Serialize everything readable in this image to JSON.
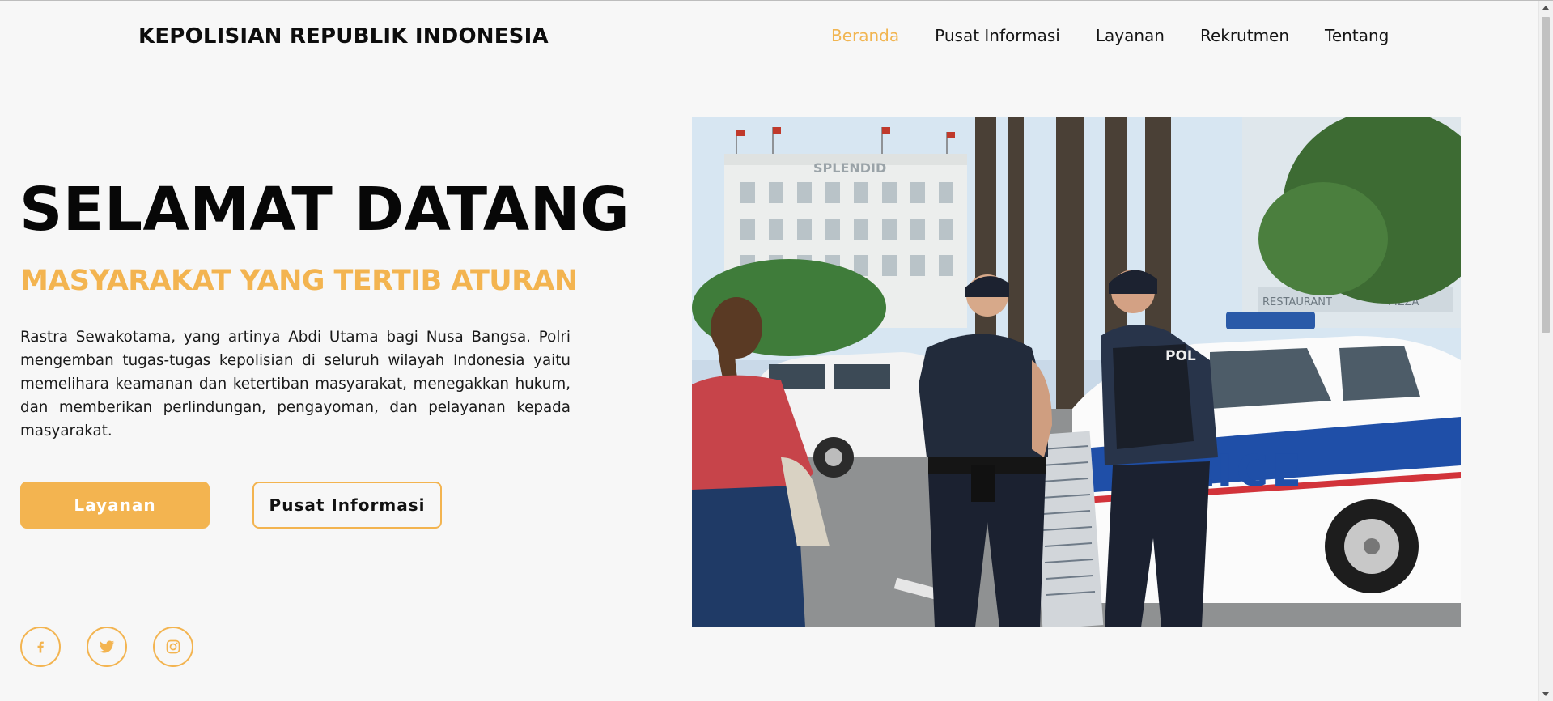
{
  "header": {
    "site_title": "KEPOLISIAN REPUBLIK INDONESIA",
    "nav": [
      {
        "label": "Beranda",
        "active": true
      },
      {
        "label": "Pusat Informasi",
        "active": false
      },
      {
        "label": "Layanan",
        "active": false
      },
      {
        "label": "Rekrutmen",
        "active": false
      },
      {
        "label": "Tentang",
        "active": false
      }
    ]
  },
  "hero": {
    "title": "SELAMAT DATANG",
    "subtitle": "MASYARAKAT YANG TERTIB ATURAN",
    "description": "Rastra Sewakotama, yang artinya Abdi Utama bagi Nusa Bangsa. Polri mengemban tugas-tugas kepolisian di seluruh wilayah Indonesia yaitu memelihara keamanan dan ketertiban masyarakat, menegakkan hukum, dan memberikan perlindungan, pengayoman, dan pelayanan kepada masyarakat.",
    "primary_button": "Layanan",
    "secondary_button": "Pusat Informasi"
  },
  "social": [
    {
      "icon": "facebook-icon"
    },
    {
      "icon": "twitter-icon"
    },
    {
      "icon": "instagram-icon"
    }
  ],
  "photo": {
    "signs": {
      "hotel": "SPLENDID",
      "car": "LICE",
      "vest": "POL",
      "restaurant": "RESTAURANT",
      "pizza": "PIZZA"
    }
  },
  "colors": {
    "accent": "#f3b450",
    "background": "#f7f7f7",
    "text": "#111111"
  }
}
